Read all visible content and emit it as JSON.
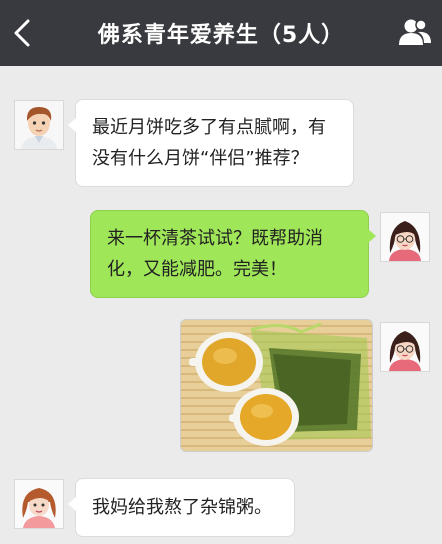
{
  "header": {
    "title": "佛系青年爱养生（5人）",
    "back_icon": "chevron-left-icon",
    "group_icon": "group-members-icon"
  },
  "messages": [
    {
      "side": "left",
      "avatar": "young-man-avatar",
      "lines": [
        "最近月饼吃多了有点腻啊，有",
        "没有什么月饼“伴侣”推荐？"
      ]
    },
    {
      "side": "right",
      "avatar": "girl-with-glasses-avatar",
      "lines": [
        "来一杯清茶试试？既帮助消",
        "化，又能减肥。完美！"
      ]
    },
    {
      "side": "right",
      "avatar": "girl-with-glasses-avatar",
      "image": "two-cups-of-green-tea-with-tea-leaves-photo"
    },
    {
      "side": "left",
      "avatar": "woman-avatar",
      "lines": [
        "我妈给我熬了杂锦粥。"
      ]
    }
  ],
  "colors": {
    "header_bg": "#393a3f",
    "chat_bg": "#ebebeb",
    "self_bubble": "#9fe658",
    "other_bubble": "#ffffff"
  }
}
